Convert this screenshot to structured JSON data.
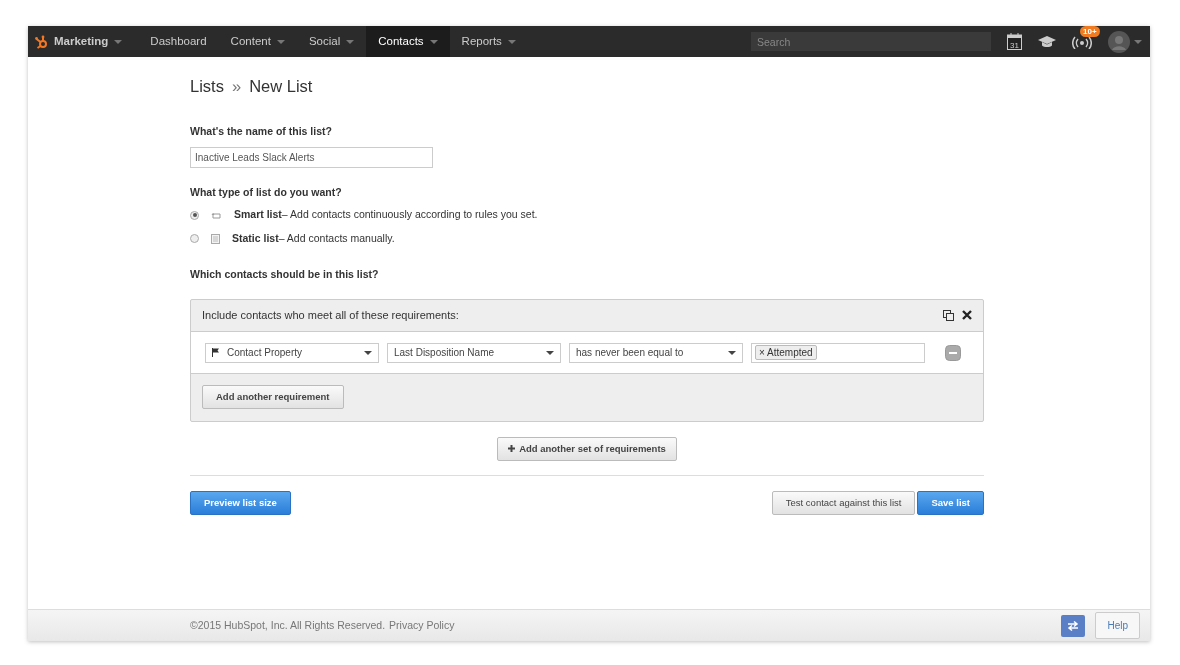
{
  "nav": {
    "brand": "Marketing",
    "brand_caret": true,
    "items": [
      {
        "label": "Dashboard",
        "caret": false,
        "selected": false
      },
      {
        "label": "Content",
        "caret": true,
        "selected": false
      },
      {
        "label": "Social",
        "caret": true,
        "selected": false
      },
      {
        "label": "Contacts",
        "caret": true,
        "selected": true
      },
      {
        "label": "Reports",
        "caret": true,
        "selected": false
      }
    ],
    "search": {
      "placeholder": "Search"
    },
    "calendar_day": "31",
    "notification_badge": "10+"
  },
  "breadcrumb": {
    "parent": "Lists",
    "separator": "»",
    "current": "New List"
  },
  "name_question": "What's the name of this list?",
  "name_field": {
    "value": "Inactive Leads Slack Alerts"
  },
  "type_question": "What type of list do you want?",
  "list_types": [
    {
      "kind": "smart",
      "name": "Smart list",
      "description": "– Add contacts continuously according to rules you set.",
      "selected": true
    },
    {
      "kind": "static",
      "name": "Static list",
      "description": "– Add contacts manually.",
      "selected": false
    }
  ],
  "contacts_question": "Which contacts should be in this list?",
  "filter_group": {
    "heading": "Include contacts who meet all of these requirements:",
    "requirements": [
      {
        "property_type": "Contact Property",
        "property": "Last Disposition Name",
        "operator": "has never been equal to",
        "tags": [
          {
            "remove": "×",
            "label": "Attempted"
          }
        ]
      }
    ],
    "add_button": "Add another requirement"
  },
  "add_set_button": "Add another set of requirements",
  "preview_button": "Preview list size",
  "test_button": "Test contact against this list",
  "save_button": "Save list",
  "footer": {
    "copyright": "©2015 HubSpot, Inc. All Rights Reserved.",
    "link": "Privacy Policy",
    "help_button": "Help"
  }
}
